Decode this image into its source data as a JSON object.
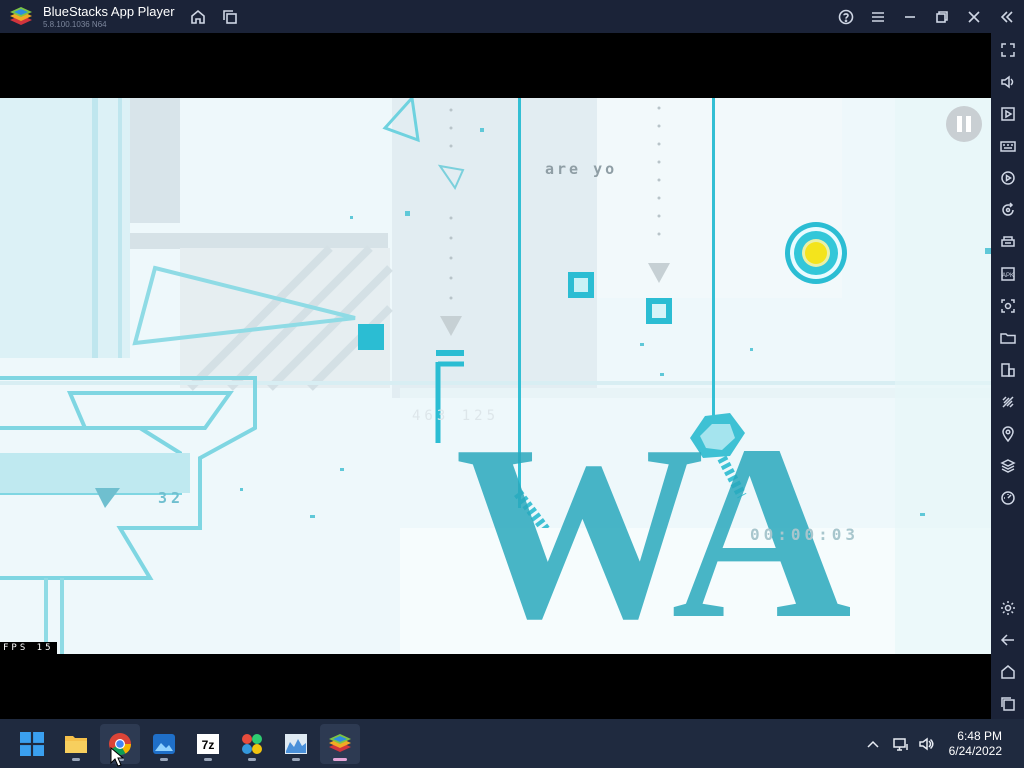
{
  "window": {
    "app_name": "BlueStacks App Player",
    "version": "5.8.100.1036 N64",
    "colors": {
      "titlebar": "#1b2338",
      "sidebar": "#1b2338",
      "taskbar": "#1f2a3f"
    }
  },
  "titlebar_icons": [
    "home-icon",
    "multi-instance-icon",
    "help-icon",
    "menu-icon",
    "minimize-icon",
    "restore-icon",
    "close-icon",
    "collapse-sidebar-icon"
  ],
  "sidebar_icons": [
    "fullscreen-icon",
    "volume-icon",
    "media-icon",
    "keyboard-icon",
    "record-icon",
    "rotate-icon",
    "macro-icon",
    "apk-icon",
    "screenshot-icon",
    "folder-icon",
    "multi-instance-icon",
    "eco-mode-icon",
    "location-icon",
    "layers-icon",
    "performance-icon",
    "settings-icon",
    "back-icon",
    "home-icon",
    "recents-icon"
  ],
  "game": {
    "text_are_you": "are yo",
    "counter_left": "32",
    "big_text": "WA",
    "faint_numbers": "463 125",
    "timer": "00:00:03",
    "fps_label": "FPS 15",
    "colors": {
      "primary": "#2bb8cf",
      "bg": "#eef8fb",
      "coin": "#f4e41c"
    }
  },
  "taskbar": {
    "apps": [
      "start-icon",
      "file-explorer-icon",
      "chrome-icon",
      "photos-icon",
      "7zip-icon",
      "apps-icon",
      "monitor-icon",
      "bluestacks-icon"
    ],
    "active_app": "bluestacks-icon",
    "time": "6:48 PM",
    "date": "6/24/2022"
  }
}
